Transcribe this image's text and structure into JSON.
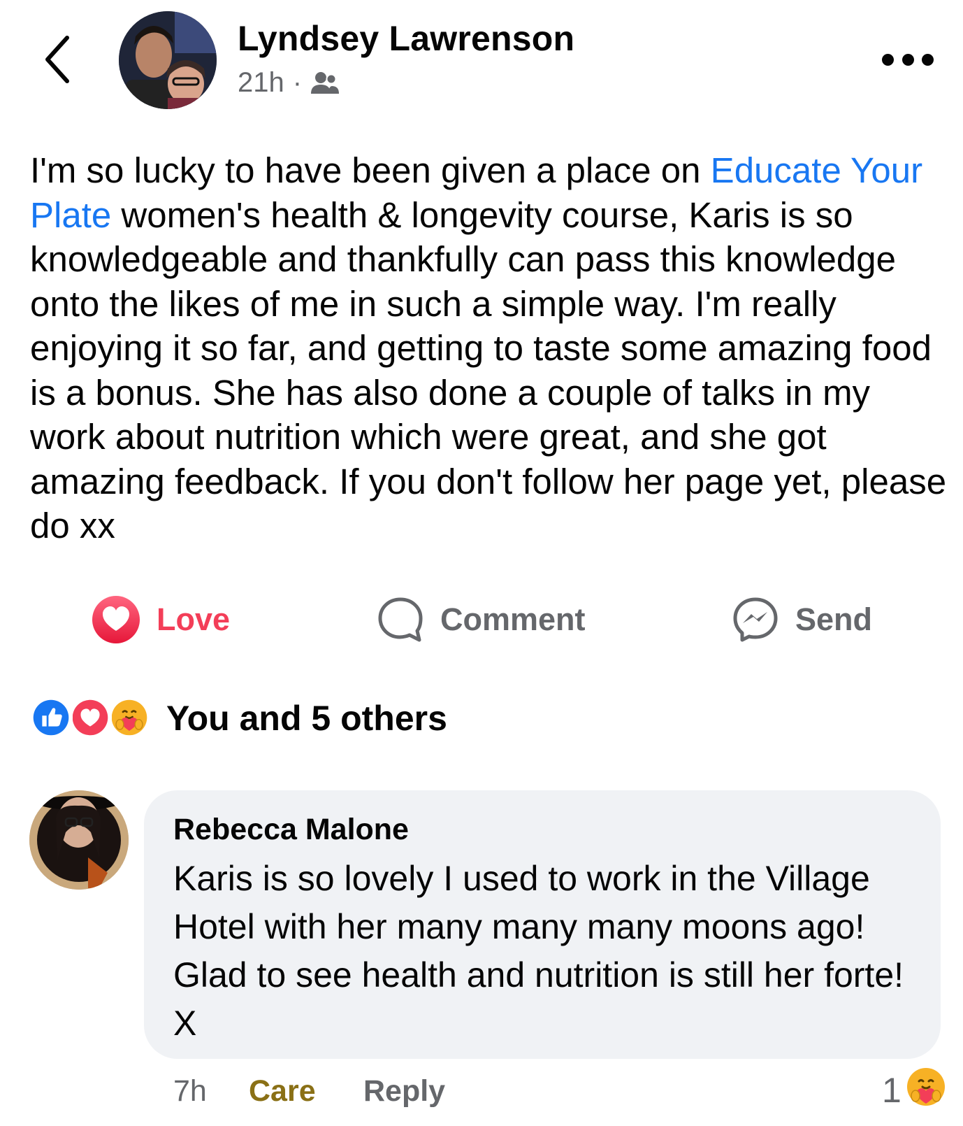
{
  "post": {
    "author": "Lyndsey Lawrenson",
    "time": "21h",
    "separator": "·",
    "audience_icon": "friends-icon",
    "text_before_link": "I'm so lucky to have been given a place on ",
    "link_text": "Educate Your Plate",
    "text_after_link": " women's health & longevity course, Karis is so knowledgeable and thankfully can pass this knowledge onto the likes of me in such a simple way. I'm really enjoying it so far, and getting to taste some amazing food is a bonus. She has also done a couple of talks in my work about nutrition which were great, and she got amazing feedback. If you don't follow her page yet, please do xx"
  },
  "actions": {
    "love_label": "Love",
    "comment_label": "Comment",
    "send_label": "Send"
  },
  "reactions": {
    "icons": [
      "like-icon",
      "love-icon",
      "care-icon"
    ],
    "label": "You and 5 others"
  },
  "comment": {
    "author": "Rebecca Malone",
    "text": "Karis is so lovely I used to work in the Village Hotel with her many many many moons ago! Glad to see health and nutrition is still her forte! X",
    "time": "7h",
    "care_label": "Care",
    "reply_label": "Reply",
    "reaction_count": "1"
  },
  "colors": {
    "link": "#1877f2",
    "love": "#f33e58",
    "care": "#8a7016",
    "muted": "#65676b",
    "bubble": "#f0f2f5"
  }
}
